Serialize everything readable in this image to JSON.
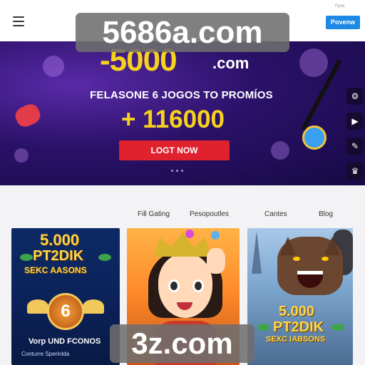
{
  "header": {
    "menu_icon": "hamburger-icon",
    "cta_label": "Povenw",
    "top_tiny_text": "Fpsb"
  },
  "watermarks": {
    "top": "5686a.com",
    "bottom": "3z.com"
  },
  "banner": {
    "brand_main": "-5000",
    "brand_suffix": ".com",
    "headline": "FELASONE 6 JOGOS TO PROMÍOS",
    "amount": "+ 116000",
    "button_label": "LOGT NOW",
    "side_tools": [
      "settings-icon",
      "play-icon",
      "edit-icon",
      "crown-icon"
    ]
  },
  "nav": {
    "items": [
      "Fill Gating",
      "Pesopoutles",
      "Cantes",
      "Blog"
    ]
  },
  "cards": [
    {
      "amount": "5.000",
      "promo": "PT2DIK",
      "sub": "SEKC AASONS",
      "emblem": "6",
      "title": "Vorp UND FCONOS",
      "desc": "Conturre Sperinlda"
    },
    {
      "label": "game-character-card"
    },
    {
      "amount": "5.000",
      "promo": "PT2DIK",
      "sub": "SEXC IABSONS"
    }
  ]
}
